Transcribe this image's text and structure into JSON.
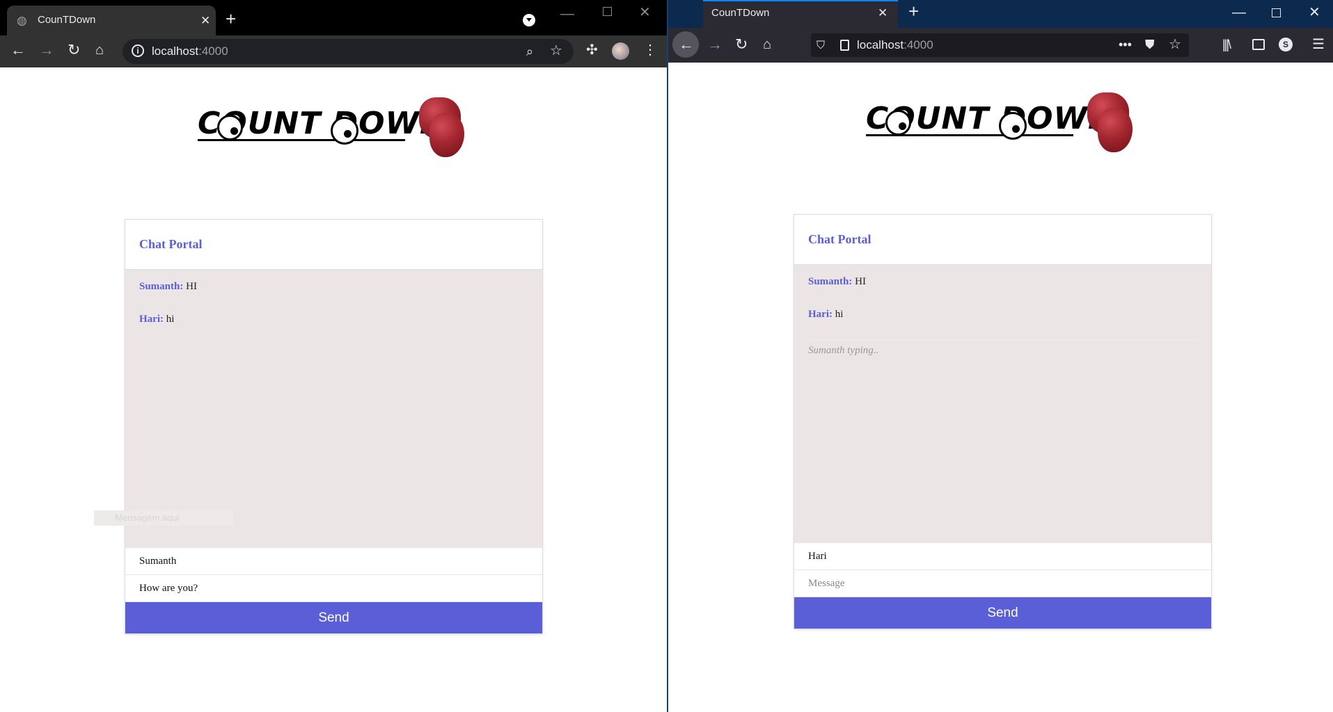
{
  "chrome": {
    "tab_title": "CounTDown",
    "new_tab_icon": "plus-icon",
    "url_host": "localhost",
    "url_port": ":4000"
  },
  "firefox": {
    "tab_title": "CounTDown",
    "url_host": "localhost",
    "url_port": ":4000",
    "account_initial": "S"
  },
  "page": {
    "logo_text": "COUNT DOWN",
    "card_title": "Chat Portal",
    "send_label": "Send",
    "message_placeholder": "Message"
  },
  "left_chat": {
    "messages": [
      {
        "sender": "Sumanth:",
        "text": " HI"
      },
      {
        "sender": "Hari:",
        "text": " hi"
      }
    ],
    "overlay_text": "Mensagem aqui",
    "name_value": "Sumanth",
    "message_value": "How are you?"
  },
  "right_chat": {
    "messages": [
      {
        "sender": "Sumanth:",
        "text": " HI"
      },
      {
        "sender": "Hari:",
        "text": " hi"
      }
    ],
    "typing": "Sumanth typing..",
    "name_value": "Hari"
  },
  "colors": {
    "accent": "#5a5fd8",
    "chat_bg": "#ebe5e5",
    "chrome_frame": "#000000",
    "firefox_frame": "#0b2a4e"
  }
}
